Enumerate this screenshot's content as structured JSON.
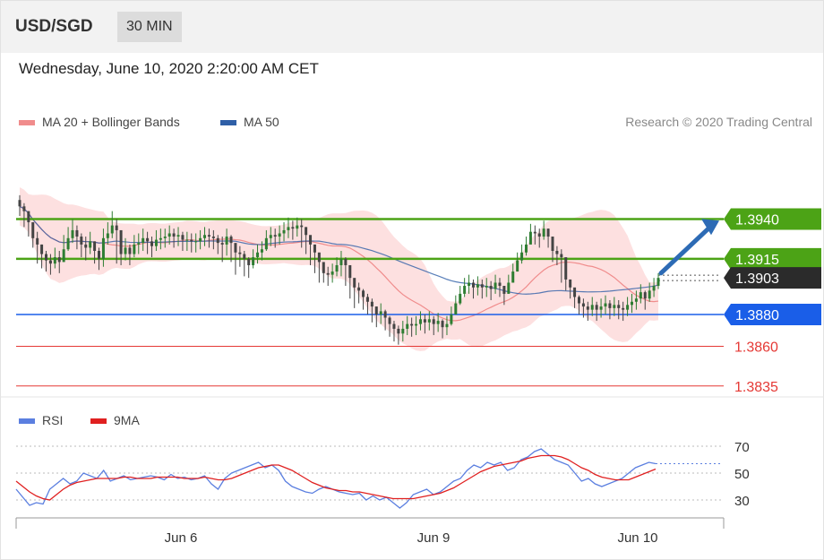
{
  "header": {
    "pair": "USD/SGD",
    "timeframe": "30 MIN"
  },
  "datetime": "Wednesday, June 10, 2020 2:20:00 AM CET",
  "legend": {
    "ma20": {
      "label": "MA 20 + Bollinger Bands",
      "color": "#f08c8c"
    },
    "ma50": {
      "label": "MA 50",
      "color": "#2f5fa7"
    },
    "credit": "Research © 2020 Trading Central"
  },
  "rsi_legend": {
    "rsi": {
      "label": "RSI",
      "color": "#5b7fe0"
    },
    "ma9": {
      "label": "9MA",
      "color": "#e02020"
    }
  },
  "price_levels": [
    {
      "value": 1.394,
      "label": "1.3940",
      "kind": "resistance",
      "color": "#4ca316"
    },
    {
      "value": 1.3915,
      "label": "1.3915",
      "kind": "resistance",
      "color": "#4ca316"
    },
    {
      "value": 1.3903,
      "label": "1.3903",
      "kind": "last",
      "color": "#2b2b2b"
    },
    {
      "value": 1.388,
      "label": "1.3880",
      "kind": "pivot",
      "color": "#1a5ee8"
    },
    {
      "value": 1.386,
      "label": "1.3860",
      "kind": "support",
      "color": "#e53935"
    },
    {
      "value": 1.3835,
      "label": "1.3835",
      "kind": "support",
      "color": "#e53935"
    }
  ],
  "x_labels": [
    "Jun 6",
    "Jun 9",
    "Jun 10"
  ],
  "rsi_ticks": [
    "70",
    "50",
    "30"
  ],
  "chart_data": [
    {
      "type": "candlestick",
      "title": "USD/SGD",
      "timeframe": "30 MIN",
      "ylim": [
        1.3827,
        1.3982
      ],
      "closes": [
        1.3948,
        1.3945,
        1.3938,
        1.3928,
        1.3924,
        1.3918,
        1.3914,
        1.3912,
        1.3916,
        1.3913,
        1.3921,
        1.3928,
        1.3933,
        1.3929,
        1.3924,
        1.3922,
        1.3926,
        1.392,
        1.3915,
        1.3928,
        1.3931,
        1.3936,
        1.3933,
        1.3918,
        1.3922,
        1.3918,
        1.3924,
        1.3925,
        1.3928,
        1.3926,
        1.3923,
        1.3927,
        1.3928,
        1.3929,
        1.3931,
        1.3929,
        1.393,
        1.3927,
        1.3927,
        1.3926,
        1.3926,
        1.3928,
        1.393,
        1.3929,
        1.3928,
        1.3925,
        1.3924,
        1.3929,
        1.3925,
        1.3919,
        1.3918,
        1.3915,
        1.3911,
        1.3916,
        1.3919,
        1.3921,
        1.3928,
        1.393,
        1.3929,
        1.3931,
        1.3933,
        1.3935,
        1.3934,
        1.3936,
        1.3935,
        1.393,
        1.3924,
        1.3919,
        1.3913,
        1.3906,
        1.3905,
        1.3907,
        1.3911,
        1.3915,
        1.3911,
        1.3903,
        1.3897,
        1.3895,
        1.3891,
        1.3888,
        1.3885,
        1.388,
        1.3882,
        1.3878,
        1.3874,
        1.3871,
        1.3868,
        1.3871,
        1.3874,
        1.3873,
        1.3874,
        1.3877,
        1.3875,
        1.3877,
        1.3874,
        1.3876,
        1.3872,
        1.3874,
        1.388,
        1.3887,
        1.3893,
        1.3898,
        1.39,
        1.3897,
        1.3899,
        1.3897,
        1.3898,
        1.3896,
        1.39,
        1.3898,
        1.3893,
        1.39,
        1.3907,
        1.3914,
        1.3919,
        1.3924,
        1.3932,
        1.3931,
        1.3929,
        1.3934,
        1.3929,
        1.392,
        1.3918,
        1.3916,
        1.3902,
        1.3897,
        1.3891,
        1.3887,
        1.3885,
        1.3883,
        1.3886,
        1.3883,
        1.3885,
        1.3887,
        1.3884,
        1.3886,
        1.3884,
        1.3883,
        1.3886,
        1.3888,
        1.389,
        1.3894,
        1.389,
        1.3895,
        1.3898,
        1.3903
      ],
      "highs": [
        1.3955,
        1.395,
        1.3945,
        1.3935,
        1.3932,
        1.3924,
        1.392,
        1.3918,
        1.3922,
        1.392,
        1.393,
        1.3935,
        1.394,
        1.3936,
        1.3931,
        1.3929,
        1.3932,
        1.3926,
        1.3922,
        1.3934,
        1.3938,
        1.3945,
        1.394,
        1.3925,
        1.3928,
        1.3924,
        1.393,
        1.3931,
        1.3934,
        1.3932,
        1.3929,
        1.3933,
        1.3934,
        1.3934,
        1.3936,
        1.3934,
        1.3935,
        1.3932,
        1.3932,
        1.3931,
        1.3931,
        1.3933,
        1.3935,
        1.3934,
        1.3933,
        1.393,
        1.3929,
        1.3934,
        1.393,
        1.3924,
        1.3923,
        1.392,
        1.3916,
        1.3921,
        1.3924,
        1.3926,
        1.3933,
        1.3935,
        1.3934,
        1.3936,
        1.3938,
        1.3941,
        1.3939,
        1.3941,
        1.394,
        1.3935,
        1.3929,
        1.3924,
        1.3918,
        1.3911,
        1.391,
        1.3912,
        1.3916,
        1.392,
        1.3916,
        1.3908,
        1.3902,
        1.39,
        1.3896,
        1.3893,
        1.389,
        1.3885,
        1.3887,
        1.3883,
        1.3879,
        1.3876,
        1.3873,
        1.3876,
        1.3879,
        1.3878,
        1.3879,
        1.3882,
        1.388,
        1.3882,
        1.3879,
        1.3881,
        1.3877,
        1.3879,
        1.3885,
        1.3892,
        1.3898,
        1.3903,
        1.3905,
        1.3902,
        1.3904,
        1.3902,
        1.3903,
        1.3901,
        1.3905,
        1.3903,
        1.3898,
        1.3905,
        1.3912,
        1.3919,
        1.3924,
        1.3929,
        1.3937,
        1.3936,
        1.3934,
        1.3939,
        1.3934,
        1.3925,
        1.3923,
        1.3921,
        1.3907,
        1.3902,
        1.3896,
        1.3892,
        1.389,
        1.3888,
        1.3891,
        1.3888,
        1.389,
        1.3892,
        1.3889,
        1.3891,
        1.3889,
        1.3888,
        1.3891,
        1.3893,
        1.3895,
        1.3899,
        1.3895,
        1.39,
        1.3903,
        1.3906
      ],
      "lows": [
        1.3942,
        1.3935,
        1.3929,
        1.3922,
        1.3912,
        1.3909,
        1.3907,
        1.3905,
        1.3909,
        1.3906,
        1.3913,
        1.392,
        1.3925,
        1.3921,
        1.3916,
        1.3914,
        1.3918,
        1.3912,
        1.3908,
        1.391,
        1.3924,
        1.3928,
        1.3912,
        1.3911,
        1.3914,
        1.3911,
        1.3916,
        1.3918,
        1.392,
        1.3918,
        1.3916,
        1.392,
        1.3921,
        1.3922,
        1.3924,
        1.3922,
        1.3923,
        1.392,
        1.392,
        1.3919,
        1.3919,
        1.3921,
        1.3923,
        1.3922,
        1.3921,
        1.3918,
        1.3913,
        1.3917,
        1.3913,
        1.3905,
        1.391,
        1.3904,
        1.3903,
        1.3909,
        1.3912,
        1.3914,
        1.392,
        1.3923,
        1.3922,
        1.3924,
        1.3926,
        1.3928,
        1.3927,
        1.3929,
        1.3922,
        1.3918,
        1.3911,
        1.3906,
        1.39,
        1.39,
        1.3898,
        1.39,
        1.3904,
        1.3904,
        1.3898,
        1.389,
        1.3884,
        1.3887,
        1.3883,
        1.388,
        1.3875,
        1.3872,
        1.3874,
        1.387,
        1.3866,
        1.3863,
        1.3861,
        1.3863,
        1.3867,
        1.3866,
        1.3867,
        1.387,
        1.3868,
        1.387,
        1.3867,
        1.3869,
        1.3865,
        1.3867,
        1.3873,
        1.388,
        1.3886,
        1.3891,
        1.3893,
        1.389,
        1.3892,
        1.389,
        1.3891,
        1.3889,
        1.3893,
        1.3891,
        1.3886,
        1.3893,
        1.39,
        1.3907,
        1.3912,
        1.3917,
        1.3925,
        1.3924,
        1.3922,
        1.3927,
        1.3922,
        1.3913,
        1.3911,
        1.39,
        1.3895,
        1.389,
        1.3884,
        1.388,
        1.3878,
        1.3876,
        1.3879,
        1.3876,
        1.3878,
        1.388,
        1.3877,
        1.3879,
        1.3877,
        1.3876,
        1.3879,
        1.3881,
        1.3883,
        1.3887,
        1.3883,
        1.3888,
        1.3891,
        1.3896
      ]
    },
    {
      "type": "line",
      "title": "RSI",
      "ylim": [
        20,
        80
      ],
      "series": [
        {
          "name": "RSI",
          "values": [
            38,
            32,
            26,
            28,
            27,
            38,
            42,
            46,
            42,
            44,
            50,
            48,
            46,
            52,
            44,
            46,
            48,
            45,
            46,
            47,
            48,
            47,
            45,
            49,
            46,
            47,
            45,
            46,
            48,
            42,
            38,
            46,
            50,
            52,
            54,
            56,
            58,
            54,
            56,
            52,
            44,
            40,
            38,
            36,
            35,
            38,
            40,
            38,
            36,
            35,
            34,
            35,
            30,
            33,
            30,
            32,
            28,
            24,
            28,
            34,
            36,
            38,
            34,
            36,
            40,
            44,
            46,
            52,
            56,
            54,
            58,
            56,
            58,
            52,
            54,
            60,
            62,
            66,
            68,
            64,
            60,
            58,
            56,
            50,
            44,
            46,
            42,
            40,
            42,
            44,
            46,
            50,
            54,
            56,
            58,
            57
          ]
        },
        {
          "name": "9MA",
          "values": [
            44,
            40,
            36,
            33,
            31,
            30,
            34,
            38,
            41,
            43,
            44,
            45,
            46,
            46,
            46,
            46,
            47,
            47,
            46,
            46,
            46,
            47,
            47,
            47,
            47,
            46,
            46,
            46,
            47,
            46,
            45,
            45,
            46,
            48,
            50,
            52,
            54,
            55,
            56,
            56,
            54,
            52,
            49,
            46,
            43,
            41,
            39,
            38,
            37,
            37,
            36,
            36,
            35,
            34,
            33,
            32,
            31,
            31,
            31,
            31,
            32,
            33,
            34,
            35,
            37,
            39,
            42,
            45,
            48,
            51,
            53,
            55,
            56,
            57,
            58,
            59,
            61,
            62,
            63,
            63,
            63,
            62,
            60,
            57,
            54,
            52,
            49,
            47,
            46,
            45,
            45,
            45,
            47,
            49,
            51,
            53
          ]
        }
      ],
      "ticks": [
        70,
        50,
        30
      ]
    }
  ]
}
